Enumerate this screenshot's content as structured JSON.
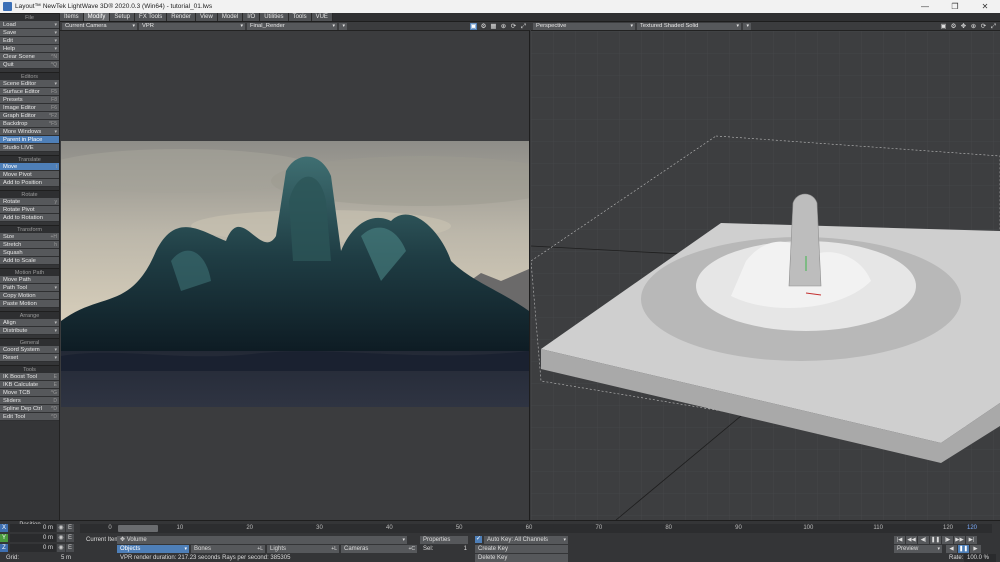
{
  "window": {
    "title": "Layout™ NewTek LightWave 3D® 2020.0.3 (Win64) - tutorial_01.lws"
  },
  "toolbar": {
    "file": {
      "header": "File",
      "items": [
        {
          "label": "Load",
          "dd": true
        },
        {
          "label": "Save",
          "dd": true
        },
        {
          "label": "Edit",
          "dd": true
        },
        {
          "label": "Help",
          "dd": true
        },
        {
          "label": "Clear Scene",
          "shortcut": "^N"
        },
        {
          "label": "Quit",
          "shortcut": "^Q"
        }
      ]
    },
    "editors": {
      "header": "Editors",
      "items": [
        {
          "label": "Scene Editor",
          "dd": true
        },
        {
          "label": "Surface Editor",
          "shortcut": "F5"
        },
        {
          "label": "Presets",
          "shortcut": "F8"
        },
        {
          "label": "Image Editor",
          "shortcut": "F6"
        },
        {
          "label": "Graph Editor",
          "shortcut": "^F2"
        },
        {
          "label": "Backdrop",
          "shortcut": "^F5"
        },
        {
          "label": "More Windows",
          "dd": true
        },
        {
          "label": "Parent in Place",
          "selected": true
        },
        {
          "label": "Studio LIVE"
        }
      ]
    },
    "translate": {
      "header": "Translate",
      "items": [
        {
          "label": "Move",
          "shortcut": "t",
          "selected": true
        },
        {
          "label": "Move Pivot"
        },
        {
          "label": "Add to Position"
        }
      ]
    },
    "rotate": {
      "header": "Rotate",
      "items": [
        {
          "label": "Rotate",
          "shortcut": "y"
        },
        {
          "label": "Rotate Pivot"
        },
        {
          "label": "Add to Rotation"
        }
      ]
    },
    "transform": {
      "header": "Transform",
      "items": [
        {
          "label": "Size",
          "shortcut": "+H"
        },
        {
          "label": "Stretch",
          "shortcut": "h"
        },
        {
          "label": "Squash"
        },
        {
          "label": "Add to Scale"
        }
      ]
    },
    "motion": {
      "header": "Motion Path",
      "items": [
        {
          "label": "Move Path"
        },
        {
          "label": "Path Tool",
          "dd": true
        },
        {
          "label": "Copy Motion"
        },
        {
          "label": "Paste Motion"
        }
      ]
    },
    "arrange": {
      "header": "Arrange",
      "items": [
        {
          "label": "Align",
          "dd": true
        },
        {
          "label": "Distribute",
          "dd": true
        }
      ]
    },
    "general": {
      "header": "General",
      "items": [
        {
          "label": "Coord System",
          "dd": true
        },
        {
          "label": "Reset",
          "dd": true
        }
      ]
    },
    "tools": {
      "header": "Tools",
      "items": [
        {
          "label": "IK Boost Tool",
          "shortcut": "E"
        },
        {
          "label": "IKB Calculate",
          "shortcut": "E"
        },
        {
          "label": "Move TCB",
          "shortcut": "^G"
        },
        {
          "label": "Sliders",
          "shortcut": "D"
        },
        {
          "label": "Spline Dep Ctrl",
          "shortcut": "^D"
        },
        {
          "label": "Edit Tool",
          "shortcut": "^D"
        }
      ]
    }
  },
  "tabs": [
    "Items",
    "Modify",
    "Setup",
    "FX Tools",
    "Render",
    "View",
    "Model",
    "I/O",
    "Utilities",
    "Tools",
    "VUE"
  ],
  "active_tab": "Modify",
  "viewport_left": {
    "view": "Current Camera",
    "mode": "VPR",
    "render_target": "Final_Render"
  },
  "viewport_right": {
    "view": "Perspective",
    "shading": "Textured Shaded Solid"
  },
  "bottom": {
    "position_label": "Position",
    "axes": [
      {
        "axis": "X",
        "value": "0 m",
        "color": "#3e6fb0"
      },
      {
        "axis": "Y",
        "value": "0 m",
        "color": "#4a9a3e"
      },
      {
        "axis": "Z",
        "value": "0 m",
        "color": "#3e6fb0"
      }
    ],
    "grid_label": "Grid:",
    "grid_value": "5 m",
    "ticks": [
      "0",
      "10",
      "20",
      "30",
      "40",
      "50",
      "60",
      "70",
      "80",
      "90",
      "100",
      "110",
      "120"
    ],
    "slider_frame": "0",
    "end_frame": "120",
    "current_item_label": "Current Item",
    "current_item": "Volume",
    "objects": "Objects",
    "bones": "Bones",
    "lights": "Lights",
    "cameras": "Cameras",
    "properties": "Properties",
    "sel_label": "Sel:",
    "sel_value": "1",
    "autokey_label": "Auto Key: All Channels",
    "create_key": "Create Key",
    "delete_key": "Delete Key",
    "status": "VPR render duration: 217.23 seconds  Rays per second: 385305",
    "preview": "Preview",
    "rate_label": "Rate:",
    "rate_value": "100.0 %"
  }
}
